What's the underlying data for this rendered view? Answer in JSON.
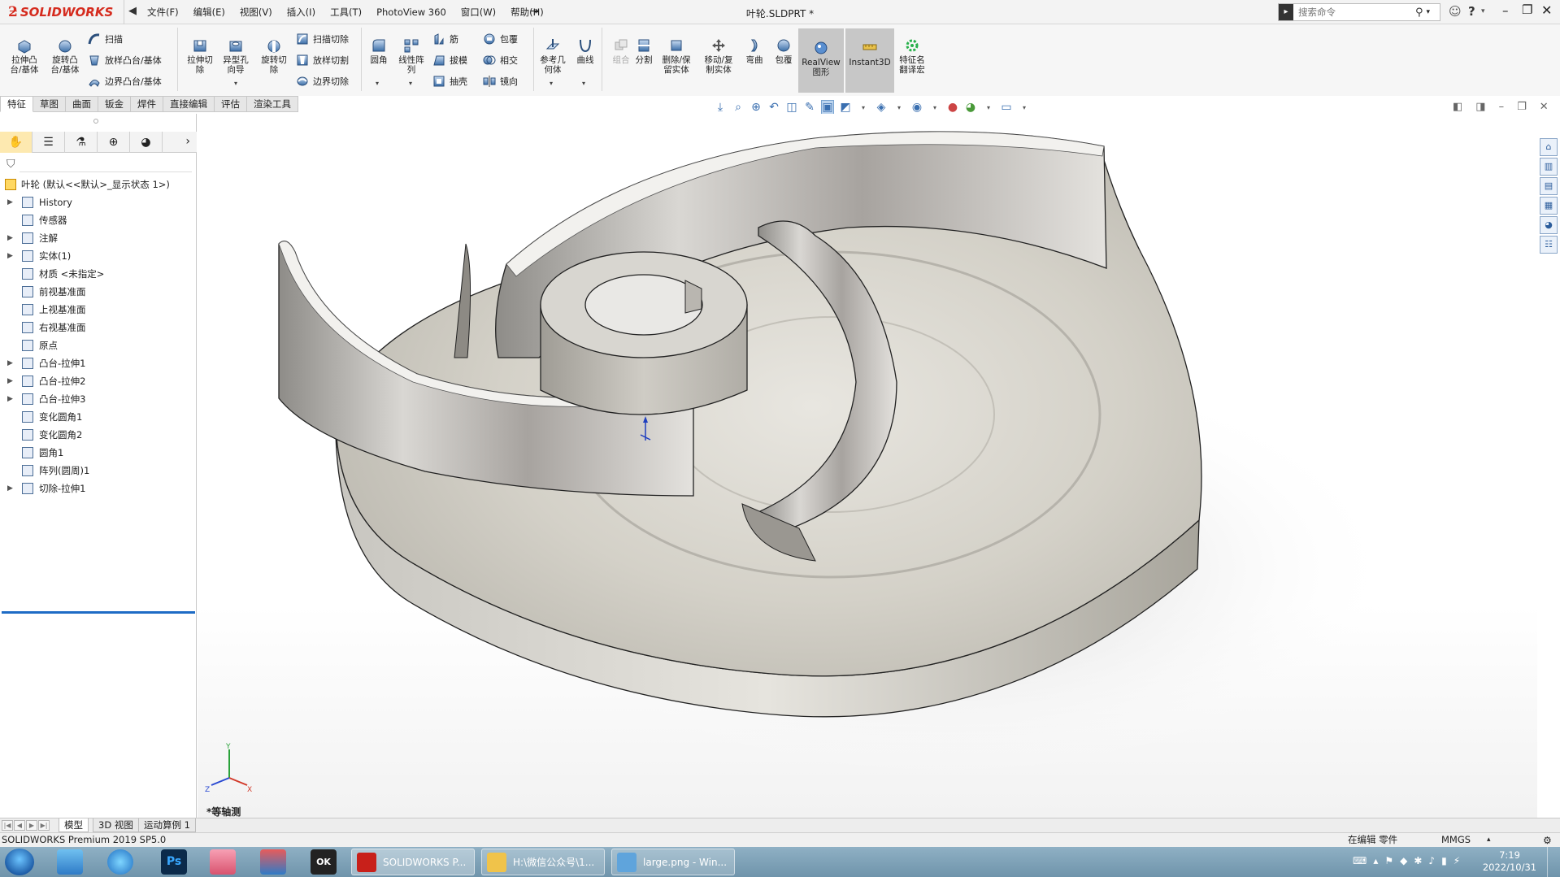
{
  "app": {
    "logo": "SOLIDWORKS",
    "document_title": "叶轮.SLDPRT *"
  },
  "menu": [
    "文件(F)",
    "编辑(E)",
    "视图(V)",
    "插入(I)",
    "工具(T)",
    "PhotoView 360",
    "窗口(W)",
    "帮助(H)"
  ],
  "search": {
    "placeholder": "搜索命令"
  },
  "ribbon": {
    "extrude_boss": "拉伸凸\n台/基体",
    "revolve_boss": "旋转凸\n台/基体",
    "sweep": "扫描",
    "loft_boss": "放样凸台/基体",
    "boundary_boss": "边界凸台/基体",
    "extrude_cut": "拉伸切\n除",
    "hole_wizard": "异型孔\n向导",
    "revolve_cut": "旋转切\n除",
    "swept_cut": "扫描切除",
    "lofted_cut": "放样切割",
    "boundary_cut": "边界切除",
    "fillet": "圆角",
    "linear_pattern": "线性阵\n列",
    "rib": "筋",
    "draft": "拔模",
    "shell": "抽壳",
    "wrap": "包覆",
    "intersect": "相交",
    "mirror": "镜向",
    "ref_geometry": "参考几\n何体",
    "curves": "曲线",
    "combine": "组合",
    "split": "分割",
    "delete_keep_body": "删除/保\n留实体",
    "move_copy_body": "移动/复\n制实体",
    "flex": "弯曲",
    "wrap2": "包覆",
    "realview": "RealView\n图形",
    "instant3d": "Instant3D",
    "feature_translate": "特征名\n翻译宏"
  },
  "command_tabs": [
    "特征",
    "草图",
    "曲面",
    "钣金",
    "焊件",
    "直接编辑",
    "评估",
    "渲染工具"
  ],
  "active_command_tab": "特征",
  "feature_tree": {
    "root": "叶轮 (默认<<默认>_显示状态 1>)",
    "items": [
      {
        "label": "History",
        "expandable": true,
        "icon": "history-icon"
      },
      {
        "label": "传感器",
        "expandable": false,
        "icon": "sensor-icon"
      },
      {
        "label": "注解",
        "expandable": true,
        "icon": "annotation-icon"
      },
      {
        "label": "实体(1)",
        "expandable": true,
        "icon": "solid-bodies-icon"
      },
      {
        "label": "材质 <未指定>",
        "expandable": false,
        "icon": "material-icon"
      },
      {
        "label": "前视基准面",
        "expandable": false,
        "icon": "plane-icon"
      },
      {
        "label": "上视基准面",
        "expandable": false,
        "icon": "plane-icon"
      },
      {
        "label": "右视基准面",
        "expandable": false,
        "icon": "plane-icon"
      },
      {
        "label": "原点",
        "expandable": false,
        "icon": "origin-icon"
      },
      {
        "label": "凸台-拉伸1",
        "expandable": true,
        "icon": "extrude-icon"
      },
      {
        "label": "凸台-拉伸2",
        "expandable": true,
        "icon": "extrude-icon"
      },
      {
        "label": "凸台-拉伸3",
        "expandable": true,
        "icon": "extrude-icon"
      },
      {
        "label": "变化圆角1",
        "expandable": false,
        "icon": "fillet-icon"
      },
      {
        "label": "变化圆角2",
        "expandable": false,
        "icon": "fillet-icon"
      },
      {
        "label": "圆角1",
        "expandable": false,
        "icon": "fillet-icon"
      },
      {
        "label": "阵列(圆周)1",
        "expandable": false,
        "icon": "circular-pattern-icon"
      },
      {
        "label": "切除-拉伸1",
        "expandable": true,
        "icon": "cut-extrude-icon"
      }
    ]
  },
  "viewport": {
    "view_name": "*等轴测"
  },
  "bottom_tabs": [
    "模型",
    "3D 视图",
    "运动算例 1"
  ],
  "active_bottom_tab": "模型",
  "status": {
    "left": "SOLIDWORKS Premium 2019 SP5.0",
    "editing": "在编辑 零件",
    "units": "MMGS"
  },
  "taskbar": {
    "windows": [
      "SOLIDWORKS P...",
      "H:\\微信公众号\\1...",
      "large.png - Win..."
    ],
    "time": "7:19",
    "date": "2022/10/31"
  },
  "colors": {
    "brand_red": "#d52b1e",
    "selection_blue": "#1e6bc5",
    "taskbar": "#7fa2b8"
  }
}
